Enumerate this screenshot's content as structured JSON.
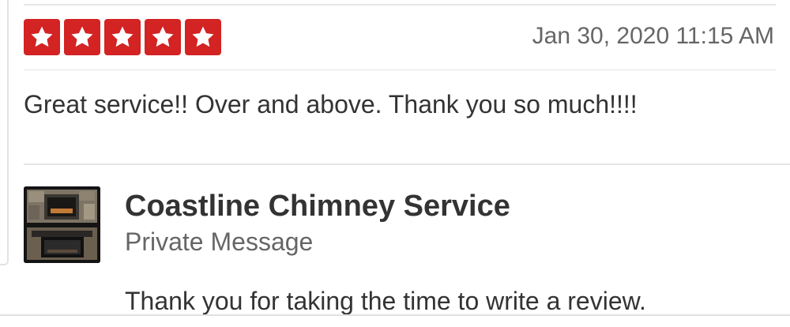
{
  "review": {
    "rating": 5,
    "rating_max": 5,
    "star_color": "#d32323",
    "date": "Jan 30, 2020 11:15 AM",
    "text": "Great service!! Over and above. Thank you so much!!!!"
  },
  "reply": {
    "business_name": "Coastline Chimney Service",
    "message_type": "Private Message",
    "text": "Thank you for taking the time to write a review."
  }
}
